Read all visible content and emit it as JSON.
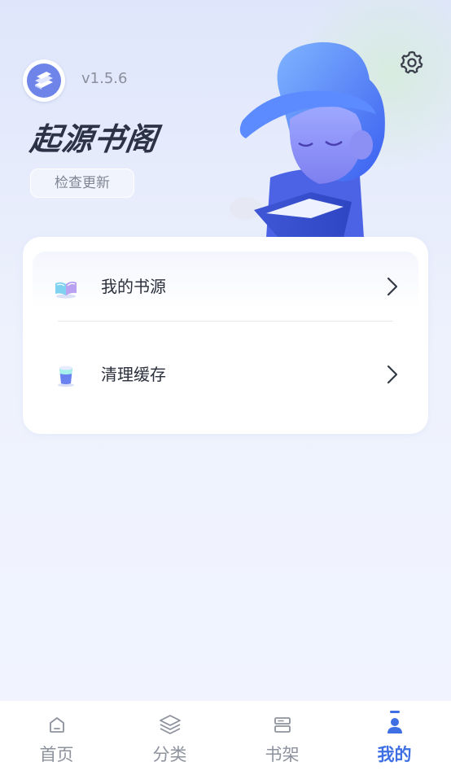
{
  "header": {
    "version": "v1.5.6",
    "app_title": "起源书阁",
    "check_update_label": "检查更新",
    "settings_icon": "gear-icon",
    "logo_icon": "books-icon"
  },
  "menu": {
    "items": [
      {
        "label": "我的书源",
        "icon": "open-book-icon"
      },
      {
        "label": "清理缓存",
        "icon": "cache-bucket-icon"
      }
    ]
  },
  "tabbar": {
    "tabs": [
      {
        "label": "首页",
        "icon": "home-icon",
        "active": false
      },
      {
        "label": "分类",
        "icon": "layers-icon",
        "active": false
      },
      {
        "label": "书架",
        "icon": "bookshelf-icon",
        "active": false
      },
      {
        "label": "我的",
        "icon": "user-icon",
        "active": true
      }
    ]
  },
  "colors": {
    "accent": "#3e6fe3",
    "title_text": "#2c3347",
    "muted_text": "#8a8f9c"
  }
}
